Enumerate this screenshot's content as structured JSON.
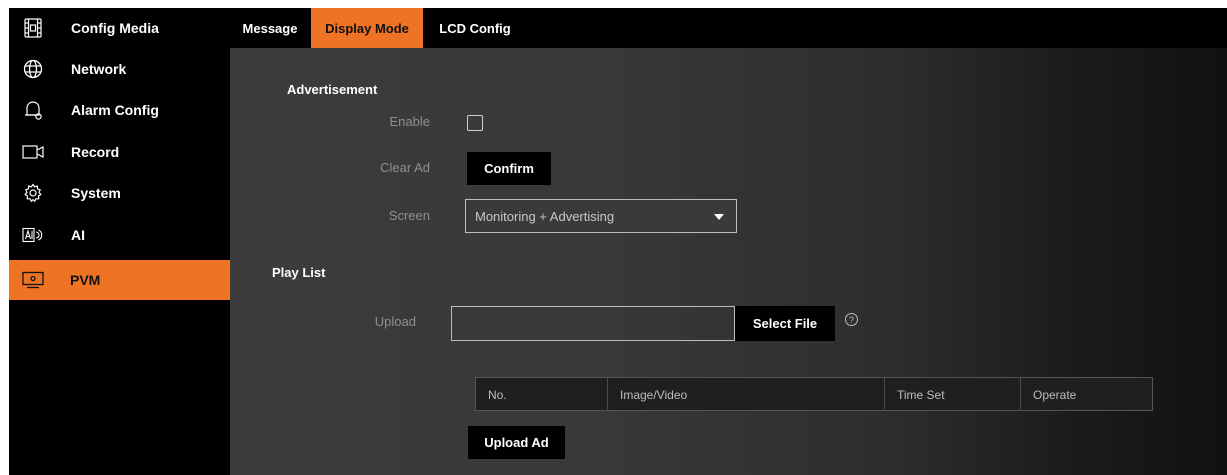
{
  "sidebar": {
    "items": [
      {
        "label": "Config Media",
        "icon": "film-strip-icon"
      },
      {
        "label": "Network",
        "icon": "globe-icon"
      },
      {
        "label": "Alarm Config",
        "icon": "bell-icon"
      },
      {
        "label": "Record",
        "icon": "camera-icon"
      },
      {
        "label": "System",
        "icon": "gear-icon"
      },
      {
        "label": "AI",
        "icon": "ai-icon"
      },
      {
        "label": "PVM",
        "icon": "monitor-icon",
        "active": true
      }
    ]
  },
  "tabs": [
    {
      "label": "Message"
    },
    {
      "label": "Display Mode",
      "active": true
    },
    {
      "label": "LCD Config"
    }
  ],
  "advertisement": {
    "title": "Advertisement",
    "enable_label": "Enable",
    "enable_checked": false,
    "clear_ad_label": "Clear Ad",
    "confirm_button": "Confirm",
    "screen_label": "Screen",
    "screen_value": "Monitoring + Advertising"
  },
  "playlist": {
    "title": "Play List",
    "upload_label": "Upload",
    "upload_value": "",
    "select_file_button": "Select File",
    "help_glyph": "?",
    "columns": [
      "No.",
      "Image/Video",
      "Time Set",
      "Operate"
    ],
    "upload_ad_button": "Upload Ad"
  },
  "colors": {
    "accent": "#ee7324",
    "sidebar_bg": "#000000",
    "content_bg": "#3a3a3a"
  }
}
